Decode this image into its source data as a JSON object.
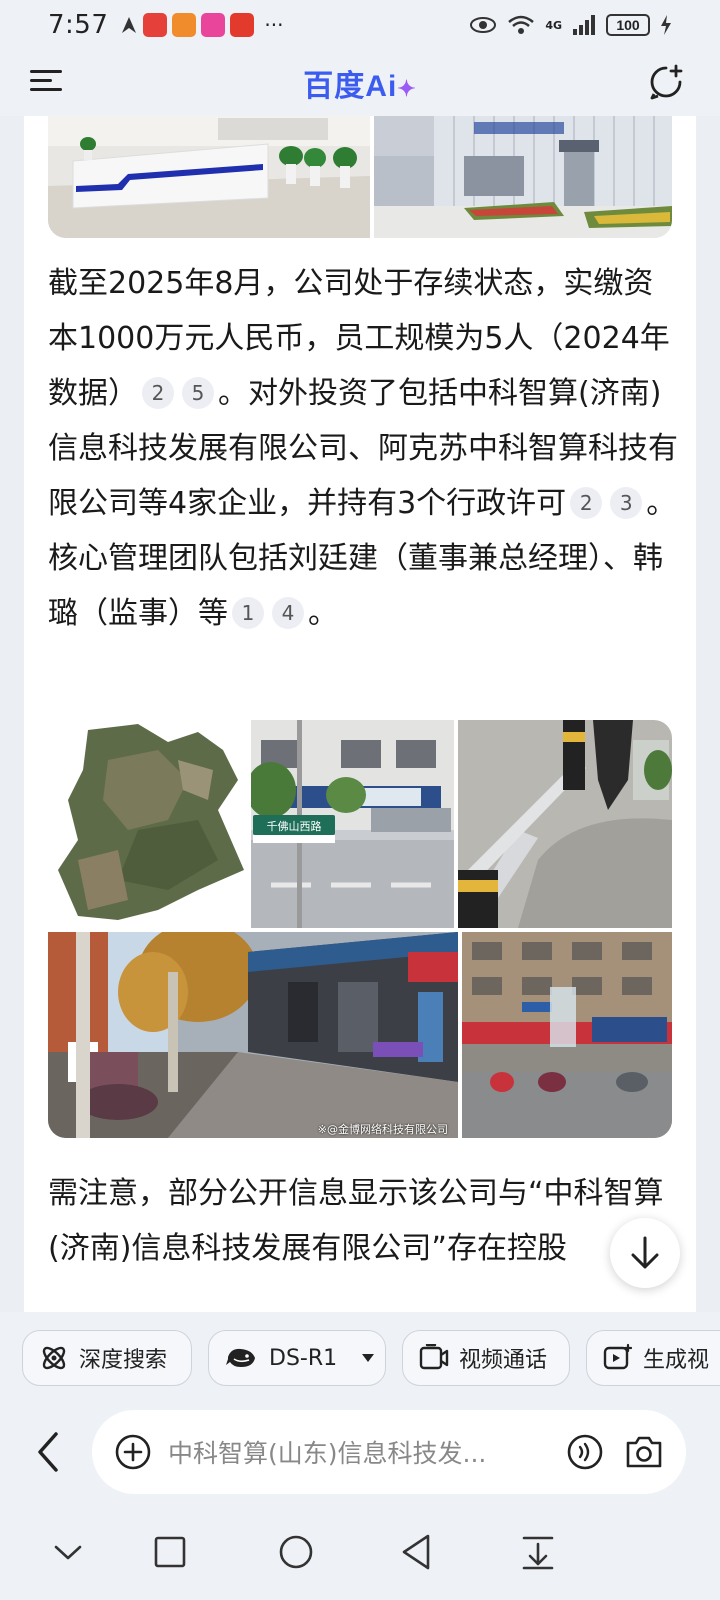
{
  "status_bar": {
    "time": "7:57",
    "dots": "···",
    "network": "4G",
    "battery": "100"
  },
  "header": {
    "logo_main": "百度Ai",
    "logo_sparkle": "✦"
  },
  "content": {
    "paragraph1": {
      "s1": "截至2025年8月，公司处于存续状态，实缴资本1000万元人民币，员工规模为5人（2024年数据）",
      "r1": "2",
      "r2": "5",
      "s2": "。对外投资了包括中科智算(济南)信息科技发展有限公司、阿克苏中科智算科技有限公司等4家企业，并持有3个行政许可",
      "r3": "2",
      "r4": "3",
      "s3": "。核心管理团队包括刘廷建（董事兼总经理）、韩璐（监事）等",
      "r5": "1",
      "r6": "4",
      "s4": "。"
    },
    "gallery_watermark": "※@金博网络科技有限公司",
    "street_sign_text": "千佛山西路",
    "paragraph2": "需注意，部分公开信息显示该公司与“中科智算(济南)信息科技发展有限公司”存在控股"
  },
  "tools": {
    "deep_search": "深度搜索",
    "model": "DS-R1",
    "video_call": "视频通话",
    "generate_video": "生成视"
  },
  "input": {
    "placeholder": "中科智算(山东)信息科技发..."
  },
  "colors": {
    "brand": "#3c5cf0",
    "accent": "#9b5cf6",
    "background": "#eef1f6"
  }
}
